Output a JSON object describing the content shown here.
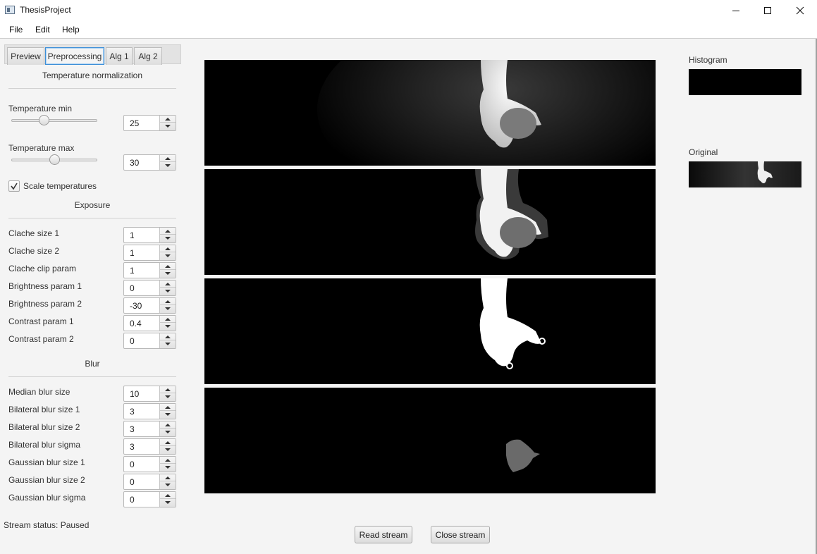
{
  "window": {
    "title": "ThesisProject"
  },
  "menu": [
    "File",
    "Edit",
    "Help"
  ],
  "tabs": [
    {
      "label": "Preview",
      "active": false
    },
    {
      "label": "Preprocessing",
      "active": true
    },
    {
      "label": "Alg 1",
      "active": false
    },
    {
      "label": "Alg 2",
      "active": false
    }
  ],
  "temperature": {
    "section_title": "Temperature normalization",
    "min": {
      "label": "Temperature min",
      "value": "25",
      "slider_fraction": 0.38
    },
    "max": {
      "label": "Temperature max",
      "value": "30",
      "slider_fraction": 0.5
    },
    "scale_checkbox": {
      "label": "Scale temperatures",
      "checked": true
    }
  },
  "exposure": {
    "section_title": "Exposure",
    "fields": [
      {
        "label": "Clache size 1",
        "value": "1"
      },
      {
        "label": "Clache size 2",
        "value": "1"
      },
      {
        "label": "Clache clip param",
        "value": "1"
      },
      {
        "label": "Brightness param 1",
        "value": "0"
      },
      {
        "label": "Brightness param 2",
        "value": "-30"
      },
      {
        "label": "Contrast param 1",
        "value": "0.4"
      },
      {
        "label": "Contrast param 2",
        "value": "0"
      }
    ]
  },
  "blur": {
    "section_title": "Blur",
    "fields": [
      {
        "label": "Median blur size",
        "value": "10"
      },
      {
        "label": "Bilateral blur size 1",
        "value": "3"
      },
      {
        "label": "Bilateral blur size 2",
        "value": "3"
      },
      {
        "label": "Bilateral blur sigma",
        "value": "3"
      },
      {
        "label": "Gaussian blur size 1",
        "value": "0"
      },
      {
        "label": "Gaussian blur size 2",
        "value": "0"
      },
      {
        "label": "Gaussian blur sigma",
        "value": "0"
      }
    ]
  },
  "status": {
    "text": "Stream status: Paused"
  },
  "side": {
    "histogram_label": "Histogram",
    "original_label": "Original"
  },
  "buttons": {
    "read": "Read stream",
    "close": "Close stream"
  },
  "icons": [
    "app-icon",
    "minimize-icon",
    "maximize-icon",
    "close-icon",
    "checkmark-icon",
    "spinner-up-icon",
    "spinner-down-icon"
  ]
}
